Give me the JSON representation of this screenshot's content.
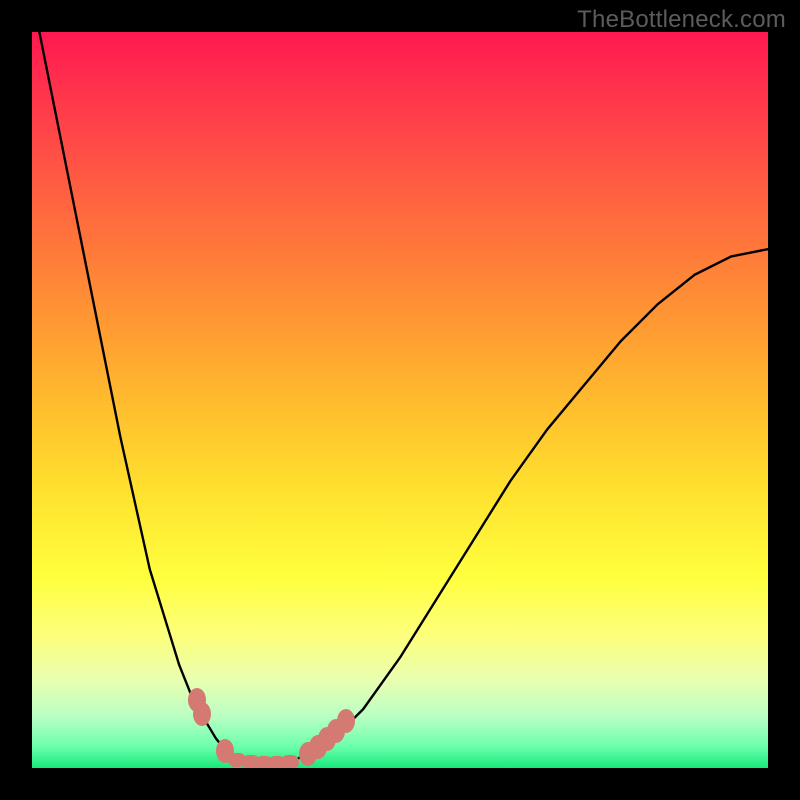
{
  "watermark": "TheBottleneck.com",
  "chart_data": {
    "type": "line",
    "title": "",
    "xlabel": "",
    "ylabel": "",
    "xlim": [
      0,
      100
    ],
    "ylim": [
      0,
      100
    ],
    "grid": false,
    "legend": false,
    "series": [
      {
        "name": "bottleneck-curve",
        "x": [
          0,
          5,
          8,
          12,
          16,
          20,
          22,
          25,
          27,
          29,
          30,
          32.5,
          35,
          40,
          45,
          50,
          55,
          60,
          65,
          70,
          75,
          80,
          85,
          90,
          95,
          100
        ],
        "y": [
          105,
          80,
          65,
          45,
          27,
          14,
          9,
          4,
          1.5,
          0.8,
          0.7,
          0.7,
          0.8,
          3,
          8,
          15,
          23,
          31,
          39,
          46,
          52,
          58,
          63,
          67,
          69.5,
          70.5
        ]
      }
    ],
    "markers": {
      "name": "highlighted-points",
      "color": "#d57a72",
      "points": [
        {
          "x": 22.4,
          "y": 9.3
        },
        {
          "x": 23.1,
          "y": 7.4
        },
        {
          "x": 26.2,
          "y": 2.3
        },
        {
          "x": 27.9,
          "y": 1.1
        },
        {
          "x": 29.7,
          "y": 0.8
        },
        {
          "x": 31.5,
          "y": 0.7
        },
        {
          "x": 33.3,
          "y": 0.7
        },
        {
          "x": 35.0,
          "y": 0.8
        },
        {
          "x": 37.5,
          "y": 1.9
        },
        {
          "x": 38.8,
          "y": 2.9
        },
        {
          "x": 40.1,
          "y": 3.9
        },
        {
          "x": 41.3,
          "y": 5.0
        },
        {
          "x": 42.7,
          "y": 6.4
        }
      ]
    },
    "background_gradient": {
      "top": "#ff1850",
      "mid": "#ffe02e",
      "bottom": "#18e87a"
    }
  }
}
